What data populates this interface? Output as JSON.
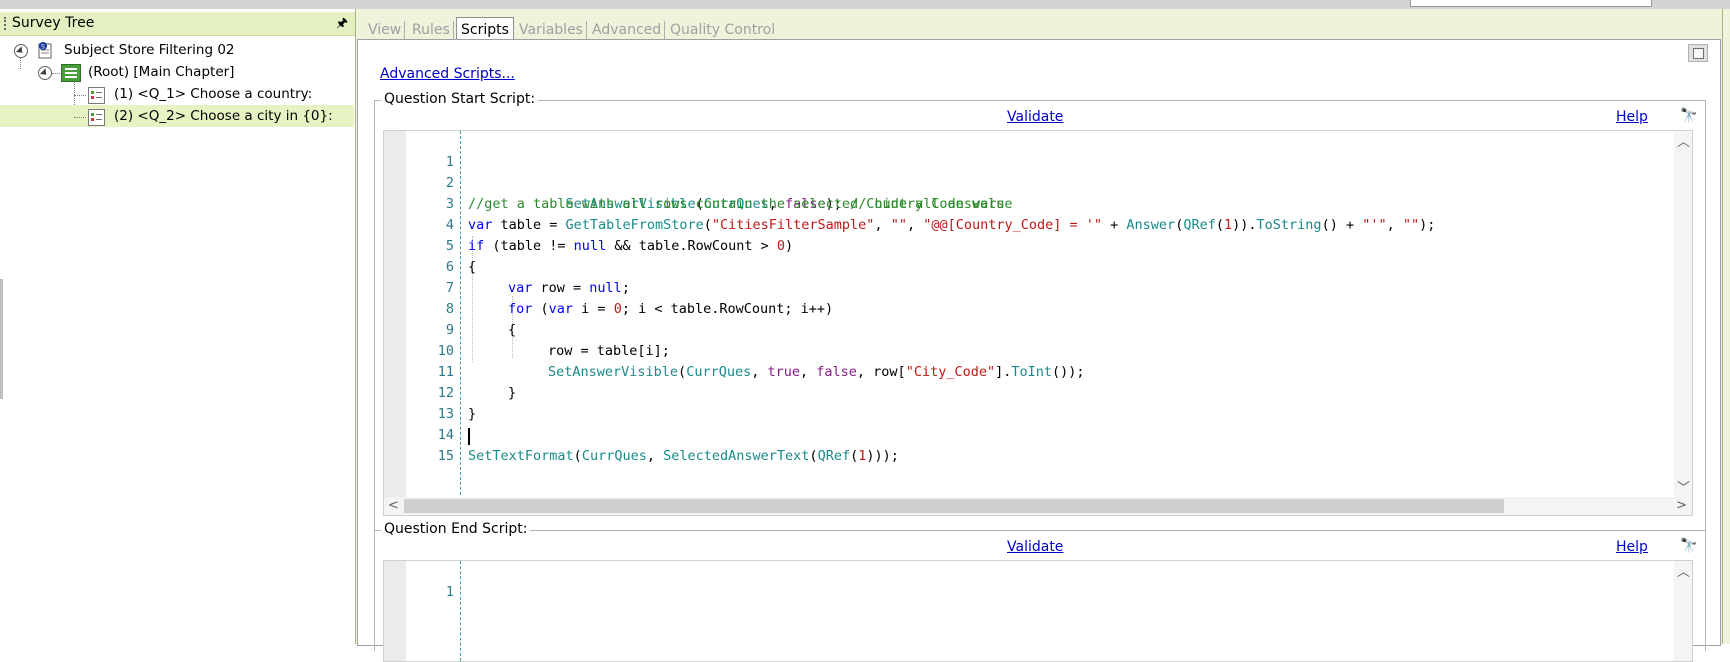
{
  "tree": {
    "title": "Survey Tree",
    "pin": "🖈",
    "nodes": [
      {
        "label": "Subject Store Filtering 02"
      },
      {
        "label": "(Root) [Main Chapter]"
      },
      {
        "label": "(1) <Q_1> Choose a country:"
      },
      {
        "label": "(2) <Q_2> Choose a city in {0}:"
      }
    ]
  },
  "tabs": [
    "View",
    "Rules",
    "Scripts",
    "Variables",
    "Advanced",
    "Quality Control"
  ],
  "active_tab": "Scripts",
  "advanced_scripts_link": "Advanced Scripts...",
  "start_script": {
    "title": "Question Start Script:",
    "validate": "Validate",
    "help": "Help",
    "lines": [
      {
        "n": "1"
      },
      {
        "n": "2"
      },
      {
        "n": "3"
      },
      {
        "n": "4"
      },
      {
        "n": "5"
      },
      {
        "n": "6"
      },
      {
        "n": "7"
      },
      {
        "n": "8"
      },
      {
        "n": "9"
      },
      {
        "n": "10"
      },
      {
        "n": "11"
      },
      {
        "n": "12"
      },
      {
        "n": "13"
      },
      {
        "n": "14"
      },
      {
        "n": "15"
      }
    ],
    "tokens": {
      "l1": [
        "SetAnswerVisible",
        "(",
        "CurrQues",
        ", ",
        "false",
        "); ",
        "// hide all answers"
      ],
      "l2": [
        "//get a table with all rows contain the selected Country Code value"
      ],
      "l3": [
        "var",
        " table = ",
        "GetTableFromStore",
        "(",
        "\"CitiesFilterSample\"",
        ", ",
        "\"\"",
        ", ",
        "\"@@[Country_Code] = '\"",
        " + ",
        "Answer",
        "(",
        "QRef",
        "(",
        "1",
        ")).",
        "ToString",
        "() + ",
        "\"'\"",
        ", ",
        "\"\"",
        ");"
      ],
      "l4": [
        "if",
        " (table != ",
        "null",
        " && table.RowCount > ",
        "0",
        ")"
      ],
      "l5": [
        "{"
      ],
      "l6": [
        "var",
        " row = ",
        "null",
        ";"
      ],
      "l7": [
        "for",
        " (",
        "var",
        " i = ",
        "0",
        "; i < table.RowCount; i++)"
      ],
      "l8": [
        "{"
      ],
      "l9": [
        "row = table[i];"
      ],
      "l10": [
        "SetAnswerVisible",
        "(",
        "CurrQues",
        ", ",
        "true",
        ", ",
        "false",
        ", row[",
        "\"City_Code\"",
        "].",
        "ToInt",
        "());"
      ],
      "l11": [
        "}"
      ],
      "l12": [
        "}"
      ],
      "l14": [
        "SetTextFormat",
        "(",
        "CurrQues",
        ", ",
        "SelectedAnswerText",
        "(",
        "QRef",
        "(",
        "1",
        ")));"
      ]
    }
  },
  "end_script": {
    "title": "Question End Script:",
    "validate": "Validate",
    "help": "Help",
    "lines": [
      {
        "n": "1"
      }
    ]
  },
  "icons": {
    "binoculars": "🔭",
    "scroll_up": "︿",
    "scroll_down": "﹀",
    "scroll_left": "<",
    "scroll_right": ">"
  },
  "colors": {
    "accent_green": "#e5f0c2",
    "link_blue": "#0000cc",
    "keyword_blue": "#0000ff",
    "function_teal": "#1a8a8a",
    "string_red": "#c01818",
    "comment_green": "#2a8a2a"
  }
}
